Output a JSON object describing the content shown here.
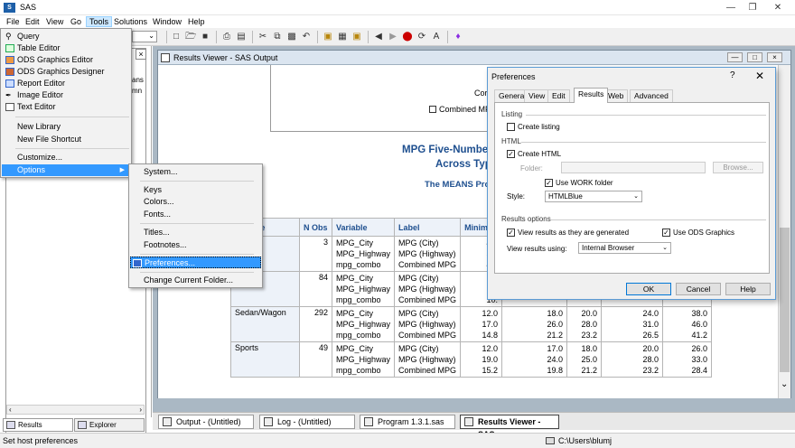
{
  "app": {
    "title": "SAS"
  },
  "menubar": [
    "File",
    "Edit",
    "View",
    "Go",
    "Tools",
    "Solutions",
    "Window",
    "Help"
  ],
  "tools_menu": {
    "items": [
      "Query",
      "Table Editor",
      "ODS Graphics Editor",
      "ODS Graphics Designer",
      "Report Editor",
      "Image Editor",
      "Text Editor",
      "New Library",
      "New File Shortcut",
      "Customize...",
      "Options"
    ]
  },
  "options_submenu": {
    "items": [
      "System...",
      "Keys",
      "Colors...",
      "Fonts...",
      "Titles...",
      "Footnotes...",
      "Preferences...",
      "Change Current Folder..."
    ]
  },
  "left_pane": {
    "fragment1": "ans",
    "fragment2": "mn",
    "tabs": [
      "Results",
      "Explorer"
    ]
  },
  "results_viewer": {
    "title": "Results Viewer - SAS Output",
    "cor_fragment": "Cor",
    "combined_fragment": "Combined MF",
    "heading1": "MPG Five-Number",
    "heading2": "Across Typ",
    "proc_title": "The MEANS Proc",
    "table": {
      "headers": [
        "ed Type",
        "N Obs",
        "Variable",
        "Label",
        "Minimu"
      ],
      "groups": [
        {
          "type": "",
          "nobs": "3",
          "vars": [
            "MPG_City",
            "MPG_Highway",
            "mpg_combo"
          ],
          "labels": [
            "MPG (City)",
            "MPG (Highway)",
            "Combined MPG"
          ],
          "mins": [
            "46.",
            "51.",
            "48."
          ],
          "cols": [
            [
              "",
              "",
              ""
            ],
            [
              "",
              "",
              ""
            ],
            [
              "",
              "",
              ""
            ],
            [
              "",
              "",
              ""
            ]
          ]
        },
        {
          "type": "ck",
          "nobs": "84",
          "vars": [
            "MPG_City",
            "MPG_Highway",
            "mpg_combo"
          ],
          "labels": [
            "MPG (City)",
            "MPG (Highway)",
            "Combined MPG"
          ],
          "mins": [
            "10.",
            "12.",
            "10."
          ],
          "cols": [
            [
              "",
              "",
              ""
            ],
            [
              "",
              "",
              ""
            ],
            [
              "",
              "",
              ""
            ],
            [
              "",
              "",
              ""
            ]
          ]
        },
        {
          "type": "Sedan/Wagon",
          "nobs": "292",
          "vars": [
            "MPG_City",
            "MPG_Highway",
            "mpg_combo"
          ],
          "labels": [
            "MPG (City)",
            "MPG (Highway)",
            "Combined MPG"
          ],
          "mins": [
            "12.0",
            "17.0",
            "14.8"
          ],
          "cols": [
            [
              "18.0",
              "26.0",
              "21.2"
            ],
            [
              "20.0",
              "28.0",
              "23.2"
            ],
            [
              "24.0",
              "31.0",
              "26.5"
            ],
            [
              "38.0",
              "46.0",
              "41.2"
            ]
          ]
        },
        {
          "type": "Sports",
          "nobs": "49",
          "vars": [
            "MPG_City",
            "MPG_Highway",
            "mpg_combo"
          ],
          "labels": [
            "MPG (City)",
            "MPG (Highway)",
            "Combined MPG"
          ],
          "mins": [
            "12.0",
            "19.0",
            "15.2"
          ],
          "cols": [
            [
              "17.0",
              "24.0",
              "19.8"
            ],
            [
              "18.0",
              "25.0",
              "21.2"
            ],
            [
              "20.0",
              "28.0",
              "23.2"
            ],
            [
              "26.0",
              "33.0",
              "28.4"
            ]
          ]
        }
      ]
    }
  },
  "taskbar": [
    "Output - (Untitled)",
    "Log - (Untitled)",
    "Program 1.3.1.sas",
    "Results Viewer - SAS ..."
  ],
  "status": {
    "left": "Set host preferences",
    "right": "C:\\Users\\blumj"
  },
  "preferences": {
    "title": "Preferences",
    "help_glyph": "?",
    "tabs": [
      "General",
      "View",
      "Edit",
      "Results",
      "Web",
      "Advanced"
    ],
    "listing_label": "Listing",
    "create_listing": "Create listing",
    "html_label": "HTML",
    "create_html": "Create HTML",
    "folder_label": "Folder:",
    "browse_label": "Browse...",
    "use_work_folder": "Use WORK folder",
    "style_label": "Style:",
    "style_value": "HTMLBlue",
    "results_options_label": "Results options",
    "view_results_generated": "View results as they are generated",
    "use_ods_graphics": "Use ODS Graphics",
    "view_results_using_label": "View results using:",
    "view_results_using_value": "Internal Browser",
    "ok": "OK",
    "cancel": "Cancel",
    "help": "Help"
  }
}
